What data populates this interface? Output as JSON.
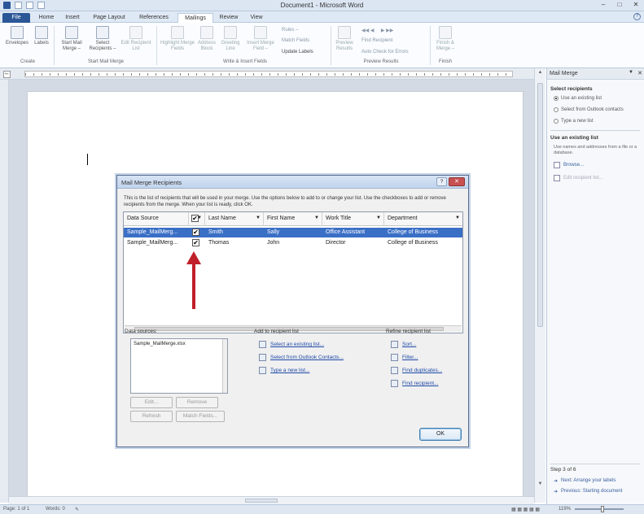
{
  "window": {
    "title": "Document1 - Microsoft Word"
  },
  "ribbon_tabs": [
    "File",
    "Home",
    "Insert",
    "Page Layout",
    "References",
    "Mailings",
    "Review",
    "View"
  ],
  "ribbon": {
    "buttons": [
      {
        "label": "Envelopes",
        "enabled": true
      },
      {
        "label": "Labels",
        "enabled": true
      },
      {
        "label": "Start Mail Merge –",
        "enabled": true
      },
      {
        "label": "Select Recipients –",
        "enabled": true
      },
      {
        "label": "Edit Recipient List",
        "enabled": false
      },
      {
        "label": "Highlight Merge Fields",
        "enabled": false
      },
      {
        "label": "Address Block",
        "enabled": false
      },
      {
        "label": "Greeting Line",
        "enabled": false
      },
      {
        "label": "Insert Merge Field –",
        "enabled": false
      },
      {
        "label": "Preview Results",
        "enabled": false
      },
      {
        "label": "Finish & Merge –",
        "enabled": false
      }
    ],
    "small_rules": "Rules –",
    "small_match": "Match Fields",
    "small_update": "Update Labels",
    "small_find": "Find Recipient",
    "small_auto": "Auto Check for Errors",
    "groups": [
      "Create",
      "Start Mail Merge",
      "Write & Insert Fields",
      "Preview Results",
      "Finish"
    ]
  },
  "task_pane": {
    "title": "Mail Merge",
    "select_recipients_heading": "Select recipients",
    "options": [
      "Use an existing list",
      "Select from Outlook contacts",
      "Type a new list"
    ],
    "use_existing_heading": "Use an existing list",
    "use_existing_text": "Use names and addresses from a file or a database.",
    "browse": "Browse...",
    "edit_list": "Edit recipient list...",
    "step": "Step 3 of 6",
    "next": "Next: Arrange your labels",
    "previous": "Previous: Starting document"
  },
  "dialog": {
    "title": "Mail Merge Recipients",
    "instructions": "This is the list of recipients that will be used in your merge. Use the options below to add to or change your list. Use the checkboxes to add or remove recipients from the merge. When your list is ready, click OK.",
    "columns": [
      "Data Source",
      "Last Name",
      "First Name",
      "Work Title",
      "Department"
    ],
    "rows": [
      {
        "source": "Sample_MailMerg...",
        "checked": true,
        "last": "Smith",
        "first": "Sally",
        "title": "Office Assistant",
        "dept": "College of Business",
        "selected": true
      },
      {
        "source": "Sample_MailMerg...",
        "checked": true,
        "last": "Thomas",
        "first": "John",
        "title": "Director",
        "dept": "College of Business",
        "selected": false
      }
    ],
    "data_sources_label": "Data sources:",
    "data_source_item": "Sample_MailMerge.xlsx",
    "edit": "Edit...",
    "refresh": "Refresh",
    "remove": "Remove",
    "match_fields": "Match Fields...",
    "add_label": "Add to recipient list",
    "add_links": [
      "Select an existing list...",
      "Select from Outlook Contacts...",
      "Type a new list..."
    ],
    "refine_label": "Refine recipient list",
    "refine_links": [
      "Sort...",
      "Filter...",
      "Find duplicates...",
      "Find recipient..."
    ],
    "ok": "OK",
    "help_glyph": "?",
    "close_glyph": "✕",
    "checkmark": "✔"
  },
  "status": {
    "page": "Page: 1 of 1",
    "words": "Words: 0",
    "zoom": "119%"
  },
  "colors": {
    "accent": "#2b579a",
    "selection": "#3a6fc6",
    "arrow": "#c0202a"
  }
}
